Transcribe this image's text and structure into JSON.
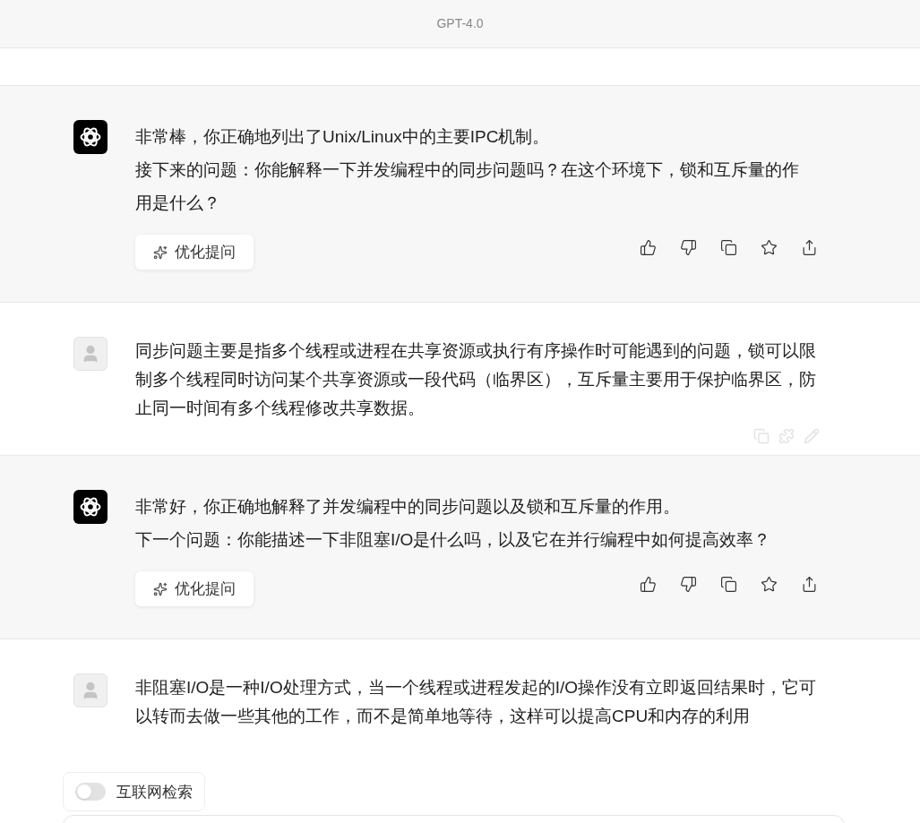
{
  "header": {
    "title": "GPT-4.0"
  },
  "messages": [
    {
      "kind": "assistant",
      "paragraphs": [
        "非常棒，你正确地列出了Unix/Linux中的主要IPC机制。",
        "接下来的问题：你能解释一下并发编程中的同步问题吗？在这个环境下，锁和互斥量的作用是什么？"
      ],
      "button": "优化提问"
    },
    {
      "kind": "user",
      "paragraphs": [
        "同步问题主要是指多个线程或进程在共享资源或执行有序操作时可能遇到的问题，锁可以限制多个线程同时访问某个共享资源或一段代码（临界区），互斥量主要用于保护临界区，防止同一时间有多个线程修改共享数据。"
      ]
    },
    {
      "kind": "assistant",
      "paragraphs": [
        "非常好，你正确地解释了并发编程中的同步问题以及锁和互斥量的作用。",
        "下一个问题：你能描述一下非阻塞I/O是什么吗，以及它在并行编程中如何提高效率？"
      ],
      "button": "优化提问"
    },
    {
      "kind": "user",
      "paragraphs": [
        "非阻塞I/O是一种I/O处理方式，当一个线程或进程发起的I/O操作没有立即返回结果时，它可以转而去做一些其他的工作，而不是简单地等待，这样可以提高CPU和内存的利用"
      ]
    }
  ],
  "web_search": {
    "label": "互联网检索",
    "on": false
  }
}
